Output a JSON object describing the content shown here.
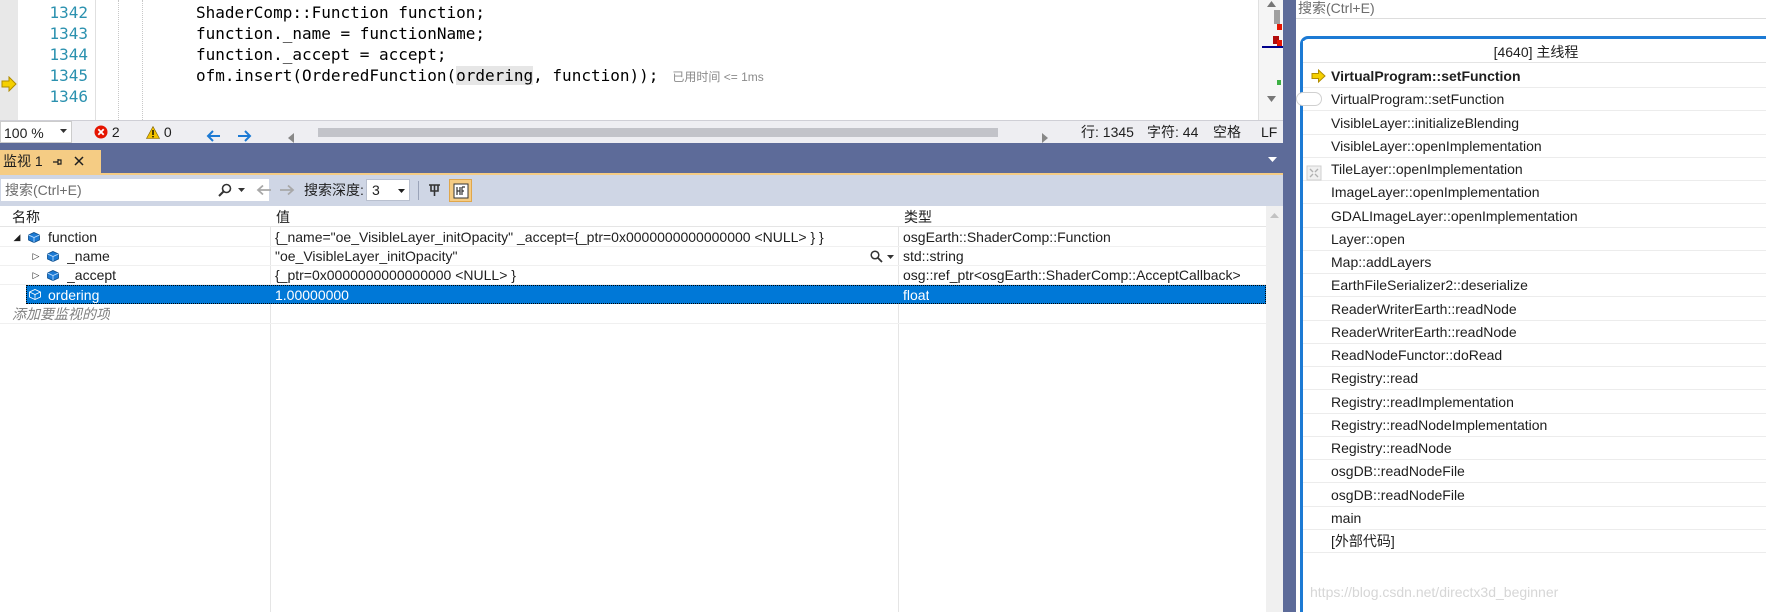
{
  "editor": {
    "lines": [
      {
        "number": "1342",
        "code": "ShaderComp::Function function;"
      },
      {
        "number": "1343",
        "code": "function._name = functionName;"
      },
      {
        "number": "1344",
        "code": "function._accept = accept;"
      },
      {
        "number": "1345",
        "code_pre": "ofm.insert(OrderedFunction(",
        "code_hl": "ordering",
        "code_post": ", function));",
        "perf_tip": "已用时间 <= 1ms"
      },
      {
        "number": "1346",
        "code": ""
      }
    ],
    "current_line_icon": "instruction-pointer-arrow-icon"
  },
  "statusbar": {
    "zoom": "100 %",
    "errors": "2",
    "warnings": "0",
    "line": "行: 1345",
    "char": "字符: 44",
    "spaces": "空格",
    "eol": "LF"
  },
  "watch": {
    "tab_label": "监视 1",
    "tab_pin": "ᅟ",
    "tab_close": "✕",
    "search_placeholder": "搜索(Ctrl+E)",
    "search_depth_label": "搜索深度:",
    "search_depth_value": "3",
    "columns": [
      "名称",
      "值",
      "类型"
    ],
    "rows": [
      {
        "name": "function",
        "value": "{_name=\"oe_VisibleLayer_initOpacity\" _accept={_ptr=0x0000000000000000 <NULL> } }",
        "type": "osgEarth::ShaderComp::Function"
      },
      {
        "name": "_name",
        "value": "\"oe_VisibleLayer_initOpacity\"",
        "type": "std::string"
      },
      {
        "name": "_accept",
        "value": "{_ptr=0x0000000000000000 <NULL> }",
        "type": "osg::ref_ptr<osgEarth::ShaderComp::AcceptCallback>"
      },
      {
        "name": "ordering",
        "value": "1.00000000",
        "type": "float"
      }
    ],
    "add_watch": "添加要监视的项"
  },
  "callstack": {
    "search_placeholder": "搜索(Ctrl+E)",
    "thread": "[4640] 主线程",
    "frames": [
      "VirtualProgram::setFunction",
      "VirtualProgram::setFunction",
      "VisibleLayer::initializeBlending",
      "VisibleLayer::openImplementation",
      "TileLayer::openImplementation",
      "ImageLayer::openImplementation",
      "GDALImageLayer::openImplementation",
      "Layer::open",
      "Map::addLayers",
      "EarthFileSerializer2::deserialize",
      "ReaderWriterEarth::readNode",
      "ReaderWriterEarth::readNode",
      "ReadNodeFunctor::doRead",
      "Registry::read",
      "Registry::readImplementation",
      "Registry::readNodeImplementation",
      "Registry::readNode",
      "osgDB::readNodeFile",
      "osgDB::readNodeFile",
      "main",
      "[外部代码]"
    ]
  },
  "watermark": "https://blog.csdn.net/directx3d_beginner",
  "colors": {
    "accent": "#0078d7",
    "tab_active": "#f5cc84",
    "panel_header": "#5d6b99",
    "error": "#e51400",
    "warning": "#f2c200"
  }
}
